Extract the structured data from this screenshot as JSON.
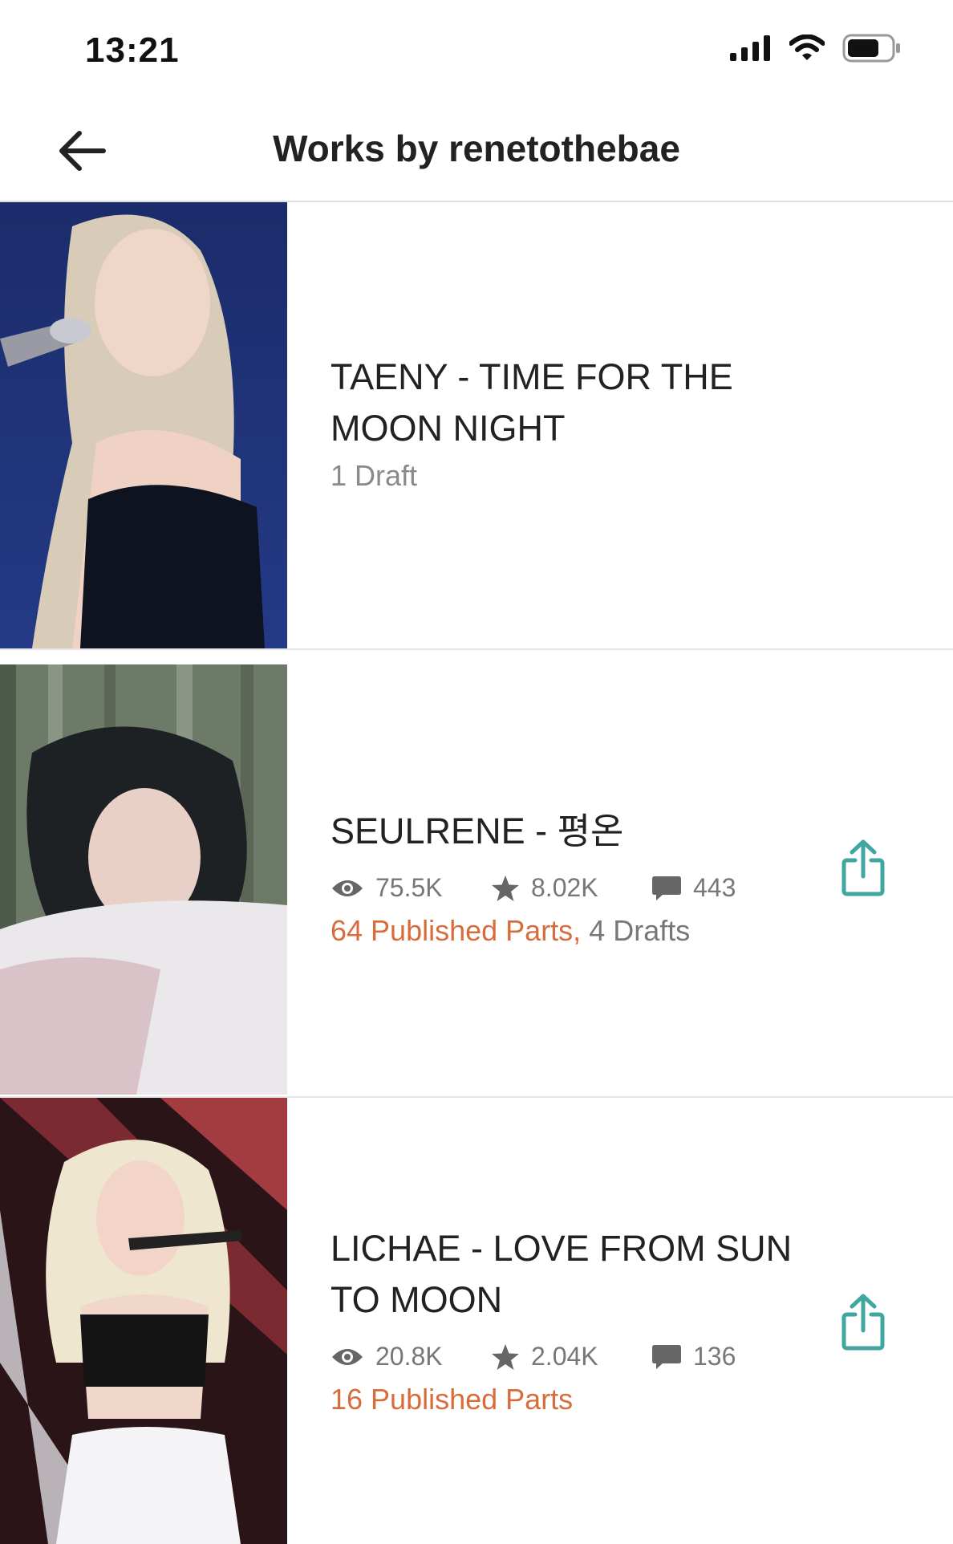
{
  "status_bar": {
    "time": "13:21"
  },
  "header": {
    "title": "Works by renetothebae"
  },
  "works": [
    {
      "title": "TAENY - TIME FOR THE MOON NIGHT",
      "drafts_label": "1 Draft"
    },
    {
      "title": "SEULRENE - 평온",
      "reads": "75.5K",
      "votes": "8.02K",
      "comments": "443",
      "published_label": "64 Published Parts,",
      "drafts_label": "4 Drafts"
    },
    {
      "title": "LICHAE - LOVE FROM SUN TO MOON",
      "reads": "20.8K",
      "votes": "2.04K",
      "comments": "136",
      "published_label": "16 Published Parts"
    }
  ],
  "colors": {
    "accent_orange": "#d96c3c",
    "share_teal": "#3fa6a0",
    "divider": "#dcdcdc",
    "muted_text": "#777777"
  },
  "icons": {
    "back": "arrow-left-icon",
    "reads": "eye-icon",
    "votes": "star-icon",
    "comments": "comment-icon",
    "share": "share-icon"
  }
}
